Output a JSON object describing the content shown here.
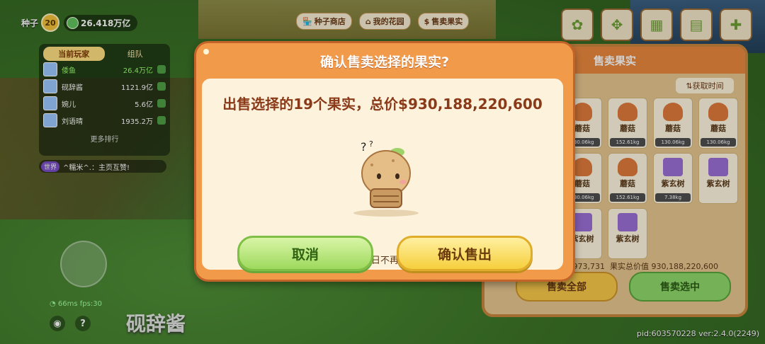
{
  "hud": {
    "seed_label": "种子",
    "level": "20",
    "money": "26.418万亿"
  },
  "players_panel": {
    "tab_current": "当前玩家",
    "tab_team": "组队",
    "rows": [
      {
        "name": "倭鱼",
        "value": "26.4万亿"
      },
      {
        "name": "砚辞酱",
        "value": "1121.9亿"
      },
      {
        "name": "婉儿",
        "value": "5.6亿"
      },
      {
        "name": "刘语晴",
        "value": "1935.2万"
      }
    ],
    "more": "更多排行"
  },
  "chat": {
    "tag": "世界",
    "text": "^糯米^.：主页互赞!"
  },
  "top_buttons": {
    "seed_shop": "种子商店",
    "my_garden": "我的花园",
    "sell_fruit": "售卖果实"
  },
  "sell_panel": {
    "title": "售卖果实",
    "sort_label": "获取时间",
    "items": [
      {
        "label": "蘑菇",
        "weight": "130.06kg"
      },
      {
        "label": "蘑菇",
        "weight": "152.61kg"
      },
      {
        "label": "蘑菇",
        "weight": "130.06kg"
      },
      {
        "label": "蘑菇",
        "weight": "130.06kg"
      },
      {
        "label": "蘑菇",
        "weight": "130.06kg"
      },
      {
        "label": "蘑菇",
        "weight": "152.61kg"
      },
      {
        "label": "紫玄树",
        "weight": "7.38kg"
      },
      {
        "label": "紫玄树",
        "weight": ""
      },
      {
        "label": "紫玄树",
        "weight": ""
      },
      {
        "label": "紫玄树",
        "weight": ""
      }
    ],
    "total_prefix": "964,973,731",
    "selected_label": "果实总价值",
    "selected_value": "930,188,220,600",
    "sell_all": "售卖全部",
    "sell_selected": "售卖选中"
  },
  "dialog": {
    "title": "确认售卖选择的果实?",
    "message": "出售选择的19个果实，总价$930,188,220,600",
    "checkbox_label": "今日不再提醒",
    "cancel": "取消",
    "confirm": "确认售出"
  },
  "footer": {
    "net": "66ms  fps:30",
    "player_name_big": "砚辞酱",
    "pid": "pid:603570228 ver:2.4.0(2249)"
  }
}
